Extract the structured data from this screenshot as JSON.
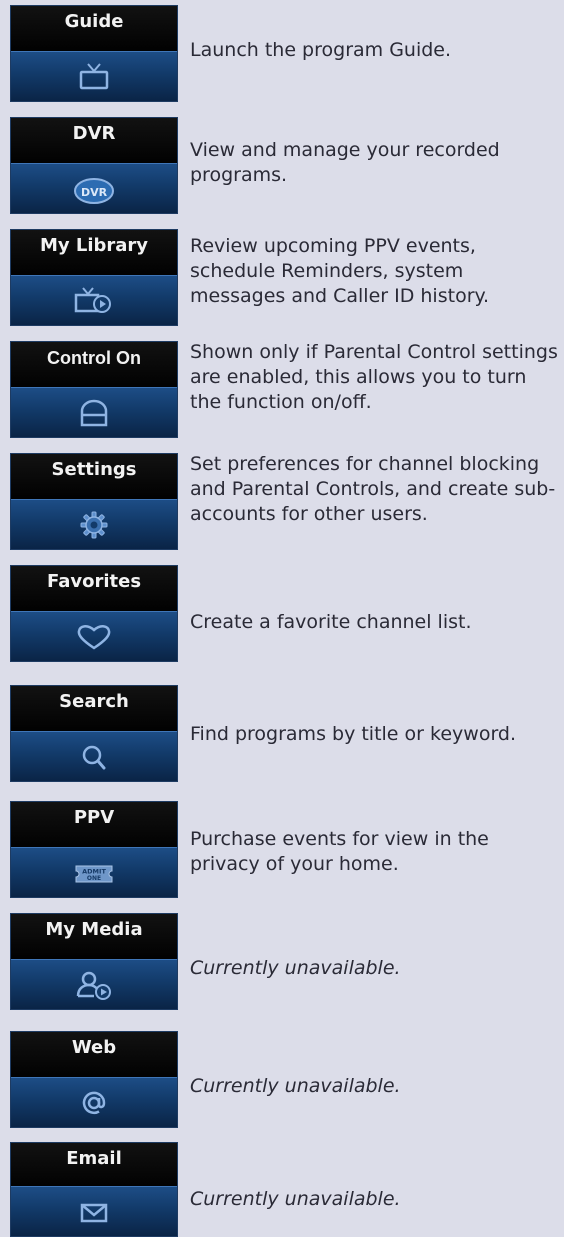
{
  "items": [
    {
      "label": "Guide",
      "icon": "tv-icon",
      "desc": "Launch the program Guide."
    },
    {
      "label": "DVR",
      "icon": "dvr-icon",
      "icon_text": "DVR",
      "desc": "View and manage your recorded programs."
    },
    {
      "label": "My Library",
      "icon": "library-icon",
      "desc": "Review upcoming PPV events, schedule Reminders, system messages and Caller ID history."
    },
    {
      "label": "Control On",
      "icon": "lock-icon",
      "desc": "Shown only if Parental Control settings are enabled, this allows you to turn the function on/off."
    },
    {
      "label": "Settings",
      "icon": "gear-icon",
      "desc": "Set preferences for channel blocking and Parental Controls, and create sub-accounts for other users."
    },
    {
      "label": "Favorites",
      "icon": "heart-icon",
      "desc": "Create a favorite channel list."
    },
    {
      "label": "Search",
      "icon": "search-icon",
      "desc": "Find programs by title or keyword."
    },
    {
      "label": "PPV",
      "icon": "ticket-icon",
      "icon_text_1": "ADMIT",
      "icon_text_2": "ONE",
      "desc": "Purchase events for view in the privacy of your home."
    },
    {
      "label": "My Media",
      "icon": "media-user-icon",
      "desc": "Currently unavailable."
    },
    {
      "label": "Web",
      "icon": "at-icon",
      "desc": "Currently unavailable."
    },
    {
      "label": "Email",
      "icon": "envelope-icon",
      "desc": "Currently unavailable."
    }
  ],
  "colors": {
    "page_bg": "#dcdde9",
    "tile_top": "#000000",
    "tile_blue": "#1d4d86",
    "icon": "#8fb4e3",
    "text": "#2a2a36"
  }
}
